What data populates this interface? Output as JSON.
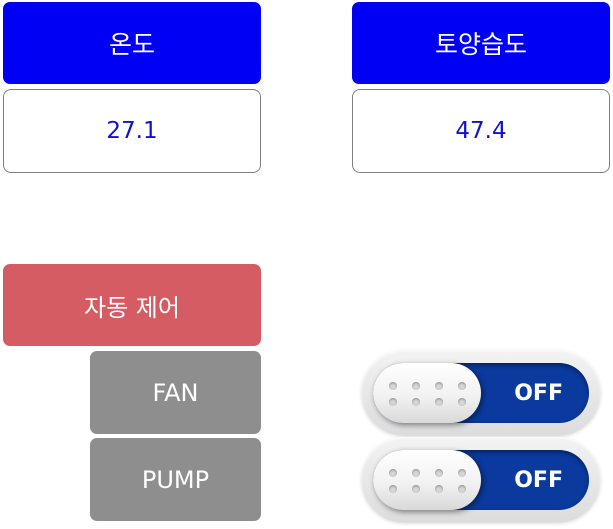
{
  "sensors": {
    "temperature": {
      "label": "온도",
      "value": "27.1"
    },
    "soil_moisture": {
      "label": "토양습도",
      "value": "47.4"
    }
  },
  "control": {
    "auto_label": "자동 제어",
    "devices": [
      {
        "label": "FAN",
        "state": "OFF"
      },
      {
        "label": "PUMP",
        "state": "OFF"
      }
    ]
  },
  "colors": {
    "header_blue": "#0000f5",
    "value_text": "#1010d0",
    "auto_red": "#d55c63",
    "device_grey": "#8e8e8e",
    "toggle_blue": "#0a3a9e"
  }
}
